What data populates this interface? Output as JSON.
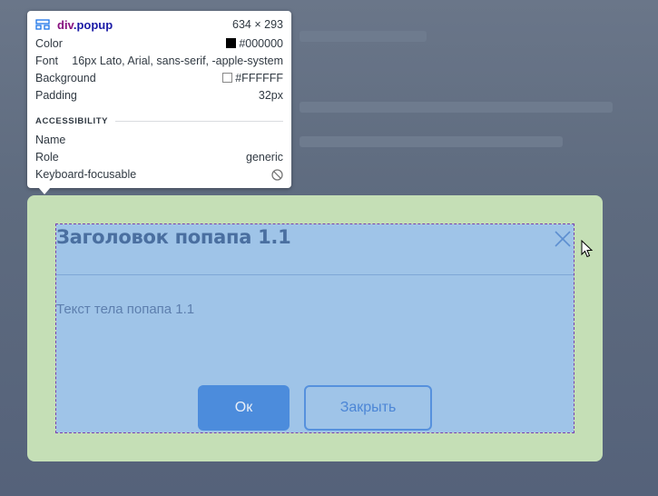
{
  "tooltip": {
    "element_tag": "div",
    "element_class": ".popup",
    "dimensions": "634 × 293",
    "rows": [
      {
        "label": "Color",
        "value": "#000000",
        "swatch": "#000000"
      },
      {
        "label": "Font",
        "value": "16px Lato, Arial, sans-serif, -apple-system"
      },
      {
        "label": "Background",
        "value": "#FFFFFF",
        "swatch": "#FFFFFF"
      },
      {
        "label": "Padding",
        "value": "32px"
      }
    ],
    "accessibility_heading": "ACCESSIBILITY",
    "a11y_rows": [
      {
        "label": "Name",
        "value": ""
      },
      {
        "label": "Role",
        "value": "generic"
      },
      {
        "label": "Keyboard-focusable",
        "value": "",
        "icon": "not-allowed-icon"
      }
    ]
  },
  "popup": {
    "title": "Заголовок попапа 1.1",
    "body_text": "Текст тела попапа 1.1",
    "ok_label": "Ок",
    "close_label": "Закрыть"
  },
  "colors": {
    "margin_highlight": "#c5dfb6",
    "content_highlight": "#9fc4e8",
    "primary_button": "#4c8cdc"
  }
}
